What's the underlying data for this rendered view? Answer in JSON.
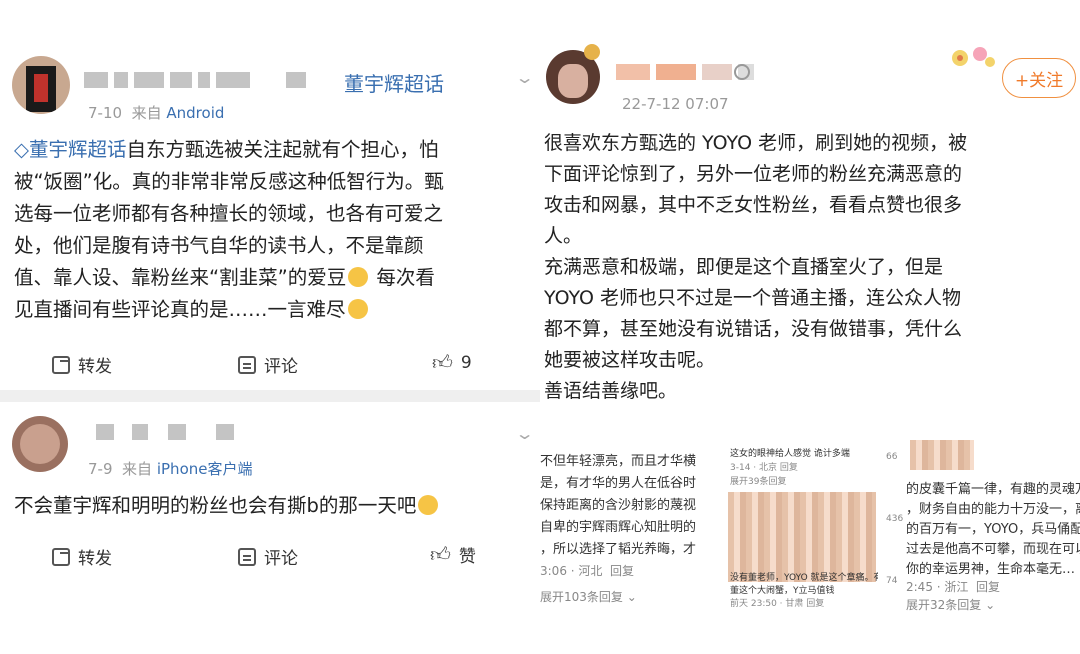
{
  "post1": {
    "name": "董宇辉超话",
    "meta_date": "7-10",
    "meta_from": "来自",
    "meta_source": "Android",
    "topic": "董宇辉超话",
    "text_lines": [
      "自东方甄选被关注起就有个担心，怕",
      "被“饭圈”化。真的非常非常反感这种低智行为。甄",
      "选每一位老师都有各种擅长的领域，也各有可爱之",
      "处，他们是腹有诗书气自华的读书人，不是靠颜",
      "值、靠人设、靠粉丝来“割韭菜”的爱豆",
      " 每次看",
      "见直播间有些评论真的是……一言难尽"
    ],
    "forward_label": "转发",
    "comment_label": "评论",
    "like_count": "9"
  },
  "post2": {
    "meta_date": "7-9",
    "meta_from": "来自",
    "meta_source": "iPhone客户端",
    "text": "不会董宇辉和明明的粉丝也会有撕b的那一天吧",
    "forward_label": "转发",
    "comment_label": "评论",
    "like_label": "赞"
  },
  "post3": {
    "date": "22-7-12 07:07",
    "follow_label": "+关注",
    "lines": [
      "很喜欢东方甄选的 YOYO 老师，刷到她的视频，被",
      "下面评论惊到了，另外一位老师的粉丝充满恶意的",
      "攻击和网暴，其中不乏女性粉丝，看看点赞也很多",
      "人。",
      "充满恶意和极端，即便是这个直播室火了，但是",
      "YOYO 老师也只不过是一个普通主播，连公众人物",
      "都不算，甚至她没有说错话，没有做错事，凭什么",
      "她要被这样攻击呢。",
      "善语结善缘吧。"
    ]
  },
  "sub1": {
    "lines": [
      "不但年轻漂亮，而且才华横",
      "是，有才华的男人在低谷时",
      "保持距离的含沙射影的蔑视",
      "自卑的宇辉雨辉心知肚明的",
      "，所以选择了韬光养晦，才"
    ],
    "meta": "3:06 · 河北",
    "reply": "回复",
    "expand": "展开103条回复"
  },
  "sub2": {
    "top": "这女的眼神给人感觉 诡计多端",
    "top_meta": "3-14 · 北京",
    "reply": "回复",
    "expand": "展开39条回复",
    "bottom1": "没有董老师，YOYO 就是这个章痛。有",
    "bottom2": "董这个大闹蟹，Y立马值钱",
    "bottom_meta": "前天 23:50 · 甘肃",
    "bottom_reply": "回复"
  },
  "sub3": {
    "lines": [
      "的皮囊千篇一律，有趣的灵魂万",
      "，财务自由的能力十万没一，离",
      "的百万有一，YOYO，兵马俑配",
      "过去是他高不可攀，而现在可以",
      "你的幸运男神，生命本毫无…"
    ],
    "counts": [
      "66",
      "436",
      "74"
    ],
    "meta": "2:45 · 浙江",
    "reply": "回复",
    "expand": "展开32条回复"
  }
}
